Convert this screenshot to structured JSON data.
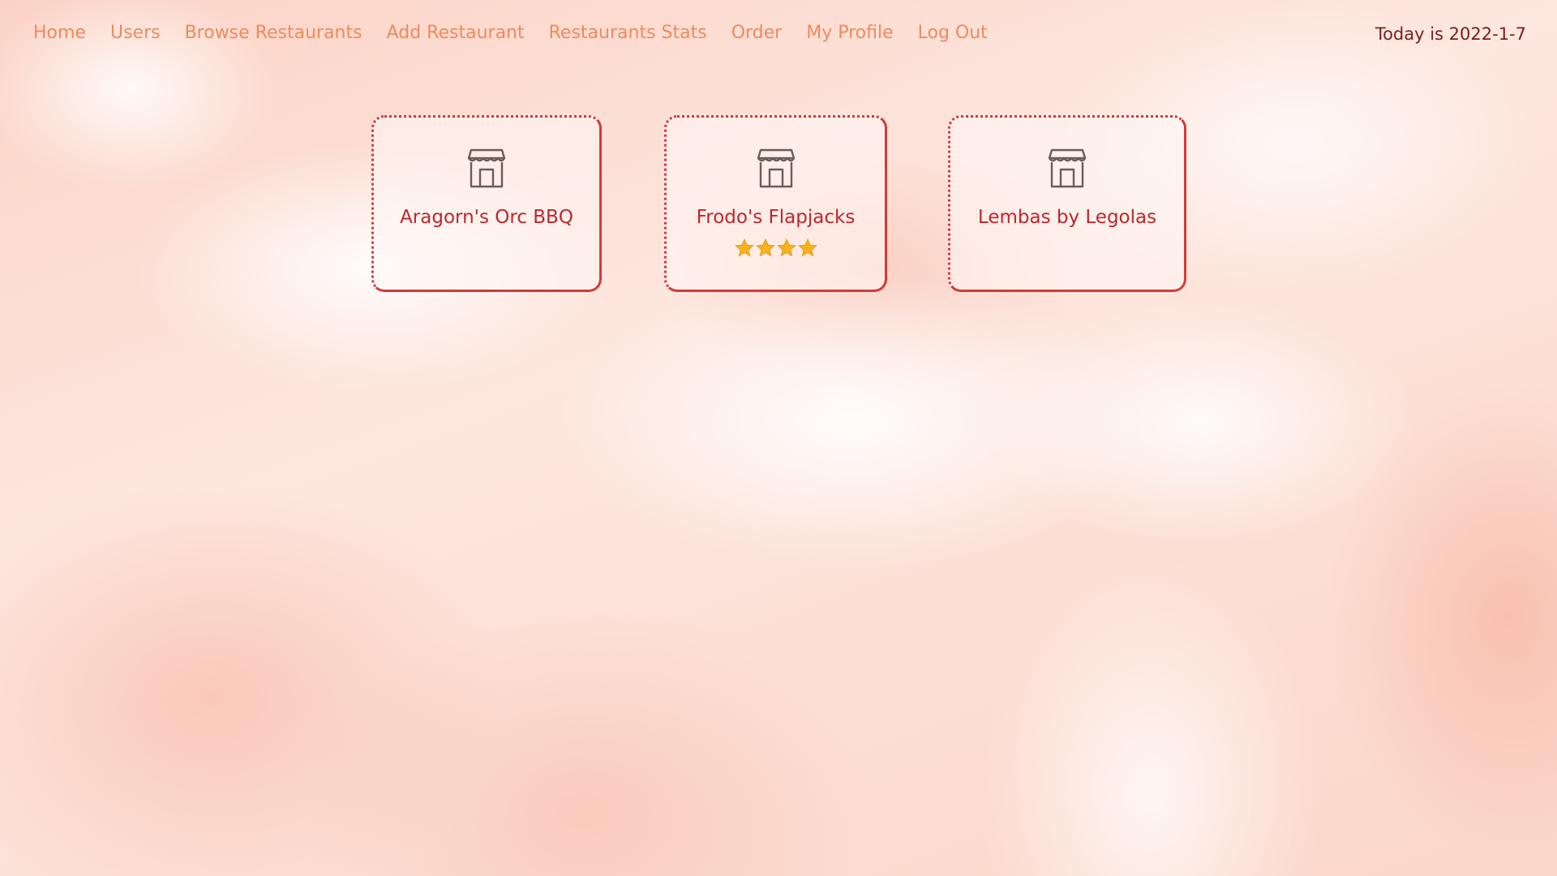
{
  "nav": {
    "links": [
      {
        "label": "Home"
      },
      {
        "label": "Users"
      },
      {
        "label": "Browse Restaurants"
      },
      {
        "label": "Add Restaurant"
      },
      {
        "label": "Restaurants Stats"
      },
      {
        "label": "Order"
      },
      {
        "label": "My Profile"
      },
      {
        "label": "Log Out"
      }
    ],
    "date_text": "Today is 2022-1-7"
  },
  "restaurants": [
    {
      "name": "Aragorn's Orc BBQ",
      "icon": "store-icon",
      "stars": 0
    },
    {
      "name": "Frodo's Flapjacks",
      "icon": "store-icon",
      "stars": 4
    },
    {
      "name": "Lembas by Legolas",
      "icon": "store-icon",
      "stars": 0
    }
  ],
  "colors": {
    "nav_link": "#f08a5c",
    "date": "#7a1e1e",
    "card_border": "#d23a3a",
    "card_title": "#c0262d",
    "star": "#f6b21d"
  }
}
